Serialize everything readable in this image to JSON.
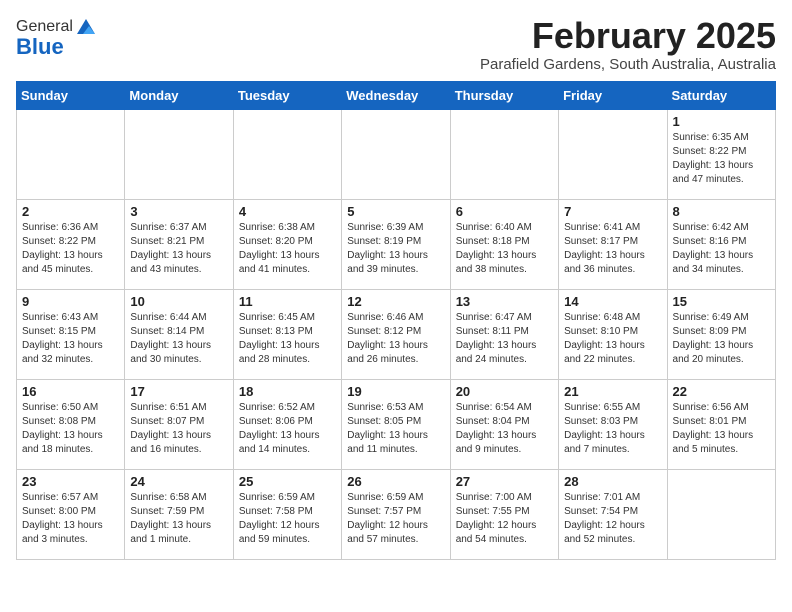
{
  "header": {
    "logo_general": "General",
    "logo_blue": "Blue",
    "month_title": "February 2025",
    "subtitle": "Parafield Gardens, South Australia, Australia"
  },
  "weekdays": [
    "Sunday",
    "Monday",
    "Tuesday",
    "Wednesday",
    "Thursday",
    "Friday",
    "Saturday"
  ],
  "weeks": [
    [
      {
        "day": "",
        "info": ""
      },
      {
        "day": "",
        "info": ""
      },
      {
        "day": "",
        "info": ""
      },
      {
        "day": "",
        "info": ""
      },
      {
        "day": "",
        "info": ""
      },
      {
        "day": "",
        "info": ""
      },
      {
        "day": "1",
        "info": "Sunrise: 6:35 AM\nSunset: 8:22 PM\nDaylight: 13 hours and 47 minutes."
      }
    ],
    [
      {
        "day": "2",
        "info": "Sunrise: 6:36 AM\nSunset: 8:22 PM\nDaylight: 13 hours and 45 minutes."
      },
      {
        "day": "3",
        "info": "Sunrise: 6:37 AM\nSunset: 8:21 PM\nDaylight: 13 hours and 43 minutes."
      },
      {
        "day": "4",
        "info": "Sunrise: 6:38 AM\nSunset: 8:20 PM\nDaylight: 13 hours and 41 minutes."
      },
      {
        "day": "5",
        "info": "Sunrise: 6:39 AM\nSunset: 8:19 PM\nDaylight: 13 hours and 39 minutes."
      },
      {
        "day": "6",
        "info": "Sunrise: 6:40 AM\nSunset: 8:18 PM\nDaylight: 13 hours and 38 minutes."
      },
      {
        "day": "7",
        "info": "Sunrise: 6:41 AM\nSunset: 8:17 PM\nDaylight: 13 hours and 36 minutes."
      },
      {
        "day": "8",
        "info": "Sunrise: 6:42 AM\nSunset: 8:16 PM\nDaylight: 13 hours and 34 minutes."
      }
    ],
    [
      {
        "day": "9",
        "info": "Sunrise: 6:43 AM\nSunset: 8:15 PM\nDaylight: 13 hours and 32 minutes."
      },
      {
        "day": "10",
        "info": "Sunrise: 6:44 AM\nSunset: 8:14 PM\nDaylight: 13 hours and 30 minutes."
      },
      {
        "day": "11",
        "info": "Sunrise: 6:45 AM\nSunset: 8:13 PM\nDaylight: 13 hours and 28 minutes."
      },
      {
        "day": "12",
        "info": "Sunrise: 6:46 AM\nSunset: 8:12 PM\nDaylight: 13 hours and 26 minutes."
      },
      {
        "day": "13",
        "info": "Sunrise: 6:47 AM\nSunset: 8:11 PM\nDaylight: 13 hours and 24 minutes."
      },
      {
        "day": "14",
        "info": "Sunrise: 6:48 AM\nSunset: 8:10 PM\nDaylight: 13 hours and 22 minutes."
      },
      {
        "day": "15",
        "info": "Sunrise: 6:49 AM\nSunset: 8:09 PM\nDaylight: 13 hours and 20 minutes."
      }
    ],
    [
      {
        "day": "16",
        "info": "Sunrise: 6:50 AM\nSunset: 8:08 PM\nDaylight: 13 hours and 18 minutes."
      },
      {
        "day": "17",
        "info": "Sunrise: 6:51 AM\nSunset: 8:07 PM\nDaylight: 13 hours and 16 minutes."
      },
      {
        "day": "18",
        "info": "Sunrise: 6:52 AM\nSunset: 8:06 PM\nDaylight: 13 hours and 14 minutes."
      },
      {
        "day": "19",
        "info": "Sunrise: 6:53 AM\nSunset: 8:05 PM\nDaylight: 13 hours and 11 minutes."
      },
      {
        "day": "20",
        "info": "Sunrise: 6:54 AM\nSunset: 8:04 PM\nDaylight: 13 hours and 9 minutes."
      },
      {
        "day": "21",
        "info": "Sunrise: 6:55 AM\nSunset: 8:03 PM\nDaylight: 13 hours and 7 minutes."
      },
      {
        "day": "22",
        "info": "Sunrise: 6:56 AM\nSunset: 8:01 PM\nDaylight: 13 hours and 5 minutes."
      }
    ],
    [
      {
        "day": "23",
        "info": "Sunrise: 6:57 AM\nSunset: 8:00 PM\nDaylight: 13 hours and 3 minutes."
      },
      {
        "day": "24",
        "info": "Sunrise: 6:58 AM\nSunset: 7:59 PM\nDaylight: 13 hours and 1 minute."
      },
      {
        "day": "25",
        "info": "Sunrise: 6:59 AM\nSunset: 7:58 PM\nDaylight: 12 hours and 59 minutes."
      },
      {
        "day": "26",
        "info": "Sunrise: 6:59 AM\nSunset: 7:57 PM\nDaylight: 12 hours and 57 minutes."
      },
      {
        "day": "27",
        "info": "Sunrise: 7:00 AM\nSunset: 7:55 PM\nDaylight: 12 hours and 54 minutes."
      },
      {
        "day": "28",
        "info": "Sunrise: 7:01 AM\nSunset: 7:54 PM\nDaylight: 12 hours and 52 minutes."
      },
      {
        "day": "",
        "info": ""
      }
    ]
  ]
}
